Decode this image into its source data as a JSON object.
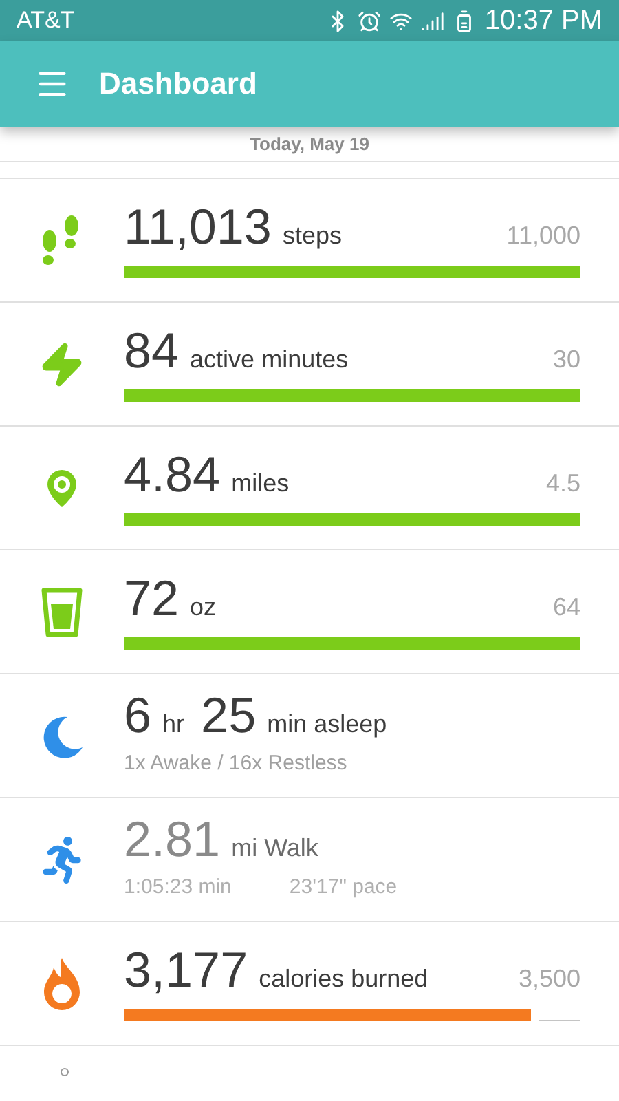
{
  "status_bar": {
    "carrier": "AT&T",
    "time": "10:37 PM"
  },
  "app_bar": {
    "title": "Dashboard"
  },
  "date": "Today, May 19",
  "tiles": [
    {
      "kind": "goal",
      "value": "11,013",
      "unit": "steps",
      "goal": "11,000",
      "level": 1,
      "color": "#7ccc1a"
    },
    {
      "kind": "goal",
      "value": "84",
      "unit": "active minutes",
      "goal": "30",
      "level": 1,
      "color": "#7ccc1a"
    },
    {
      "kind": "goal",
      "value": "4.84",
      "unit": "miles",
      "goal": "4.5",
      "level": 1,
      "color": "#7ccc1a"
    },
    {
      "kind": "goal",
      "value": "72",
      "unit": "oz",
      "goal": "64",
      "level": 1,
      "color": "#7ccc1a"
    },
    {
      "kind": "sleep",
      "hours": "6",
      "hours_unit": "hr",
      "minutes": "25",
      "minutes_unit": "min asleep",
      "detail": "1x Awake / 16x Restless"
    },
    {
      "kind": "exercise",
      "value": "2.81",
      "unit": "mi Walk",
      "duration": "1:05:23 min",
      "pace": "23'17\" pace"
    },
    {
      "kind": "goal",
      "value": "3,177",
      "unit": "calories burned",
      "goal": "3,500",
      "level": 0.91,
      "color": "#f47a20"
    },
    {
      "kind": "partial"
    }
  ]
}
